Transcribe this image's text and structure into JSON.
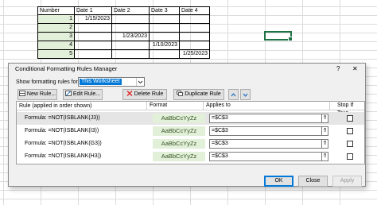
{
  "sheet": {
    "header_number": "Number",
    "header_date1": "Date 1",
    "header_date2": "Date 2",
    "header_date3": "Date 3",
    "header_date4": "Date 4",
    "rows": [
      {
        "num": "1",
        "d1": "1/15/2023",
        "d2": "",
        "d3": "",
        "d4": ""
      },
      {
        "num": "2",
        "d1": "",
        "d2": "",
        "d3": "",
        "d4": ""
      },
      {
        "num": "3",
        "d1": "",
        "d2": "1/23/2023",
        "d3": "",
        "d4": ""
      },
      {
        "num": "4",
        "d1": "",
        "d2": "",
        "d3": "1/10/2023",
        "d4": ""
      },
      {
        "num": "5",
        "d1": "",
        "d2": "",
        "d3": "",
        "d4": "1/25/2023"
      }
    ]
  },
  "dialog": {
    "title": "Conditional Formatting Rules Manager",
    "help": "?",
    "close": "✕",
    "show_rules_label": "Show formatting rules for:",
    "show_rules_value": "This Worksheet",
    "new_rule": "New Rule...",
    "edit_rule": "Edit Rule...",
    "delete_rule": "Delete Rule",
    "duplicate_rule": "Duplicate Rule",
    "col_rule": "Rule (applied in order shown)",
    "col_format": "Format",
    "col_applies": "Applies to",
    "col_stop": "Stop If True",
    "rules": [
      {
        "rule": "Formula: =NOT(ISBLANK(J3))",
        "format": "AaBbCcYyZz",
        "applies": "=$C$3",
        "stop": false
      },
      {
        "rule": "Formula: =NOT(ISBLANK(I3))",
        "format": "AaBbCcYyZz",
        "applies": "=$C$3",
        "stop": false
      },
      {
        "rule": "Formula: =NOT(ISBLANK(G3))",
        "format": "AaBbCcYyZz",
        "applies": "=$C$3",
        "stop": false
      },
      {
        "rule": "Formula: =NOT(ISBLANK(H3))",
        "format": "AaBbCcYyZz",
        "applies": "=$C$3",
        "stop": false
      }
    ],
    "ok": "OK",
    "close_btn": "Close",
    "apply": "Apply"
  },
  "colors": {
    "accent": "#217346",
    "format_preview_bg": "#e2efd9",
    "format_preview_text": "#375623",
    "selected_row_bg": "#e5e5e5",
    "combo_highlight": "#0078d7"
  },
  "icons": {
    "new_rule": "new-rule-icon",
    "edit_rule": "edit-rule-icon",
    "delete_rule": "delete-x-icon",
    "duplicate_rule": "duplicate-icon",
    "move_up": "chevron-up-icon",
    "move_down": "chevron-down-icon",
    "range_picker": "collapse-dialog-icon"
  }
}
